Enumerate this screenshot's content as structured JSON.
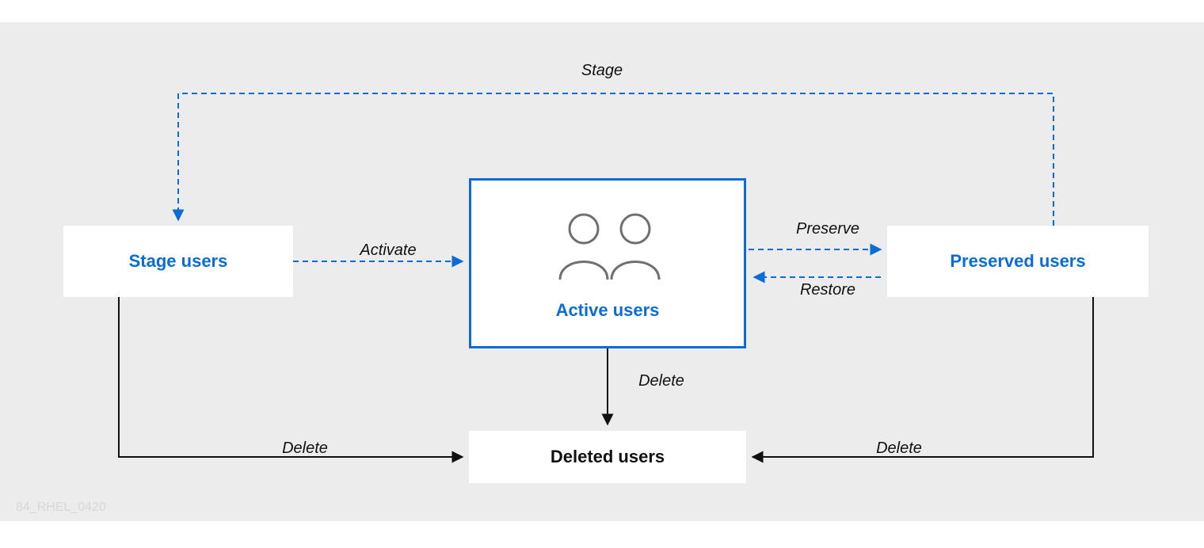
{
  "nodes": {
    "stage": {
      "label": "Stage users"
    },
    "active": {
      "label": "Active users"
    },
    "preserved": {
      "label": "Preserved users"
    },
    "deleted": {
      "label": "Deleted users"
    }
  },
  "edges": {
    "stage": {
      "label": "Stage"
    },
    "activate": {
      "label": "Activate"
    },
    "preserve": {
      "label": "Preserve"
    },
    "restore": {
      "label": "Restore"
    },
    "delete_active": {
      "label": "Delete"
    },
    "delete_stage": {
      "label": "Delete"
    },
    "delete_preserved": {
      "label": "Delete"
    }
  },
  "footer_id": "84_RHEL_0420",
  "colors": {
    "blue": "#0a6cd6",
    "gray_bg": "#ececec",
    "icon_gray": "#6f6f6f"
  }
}
